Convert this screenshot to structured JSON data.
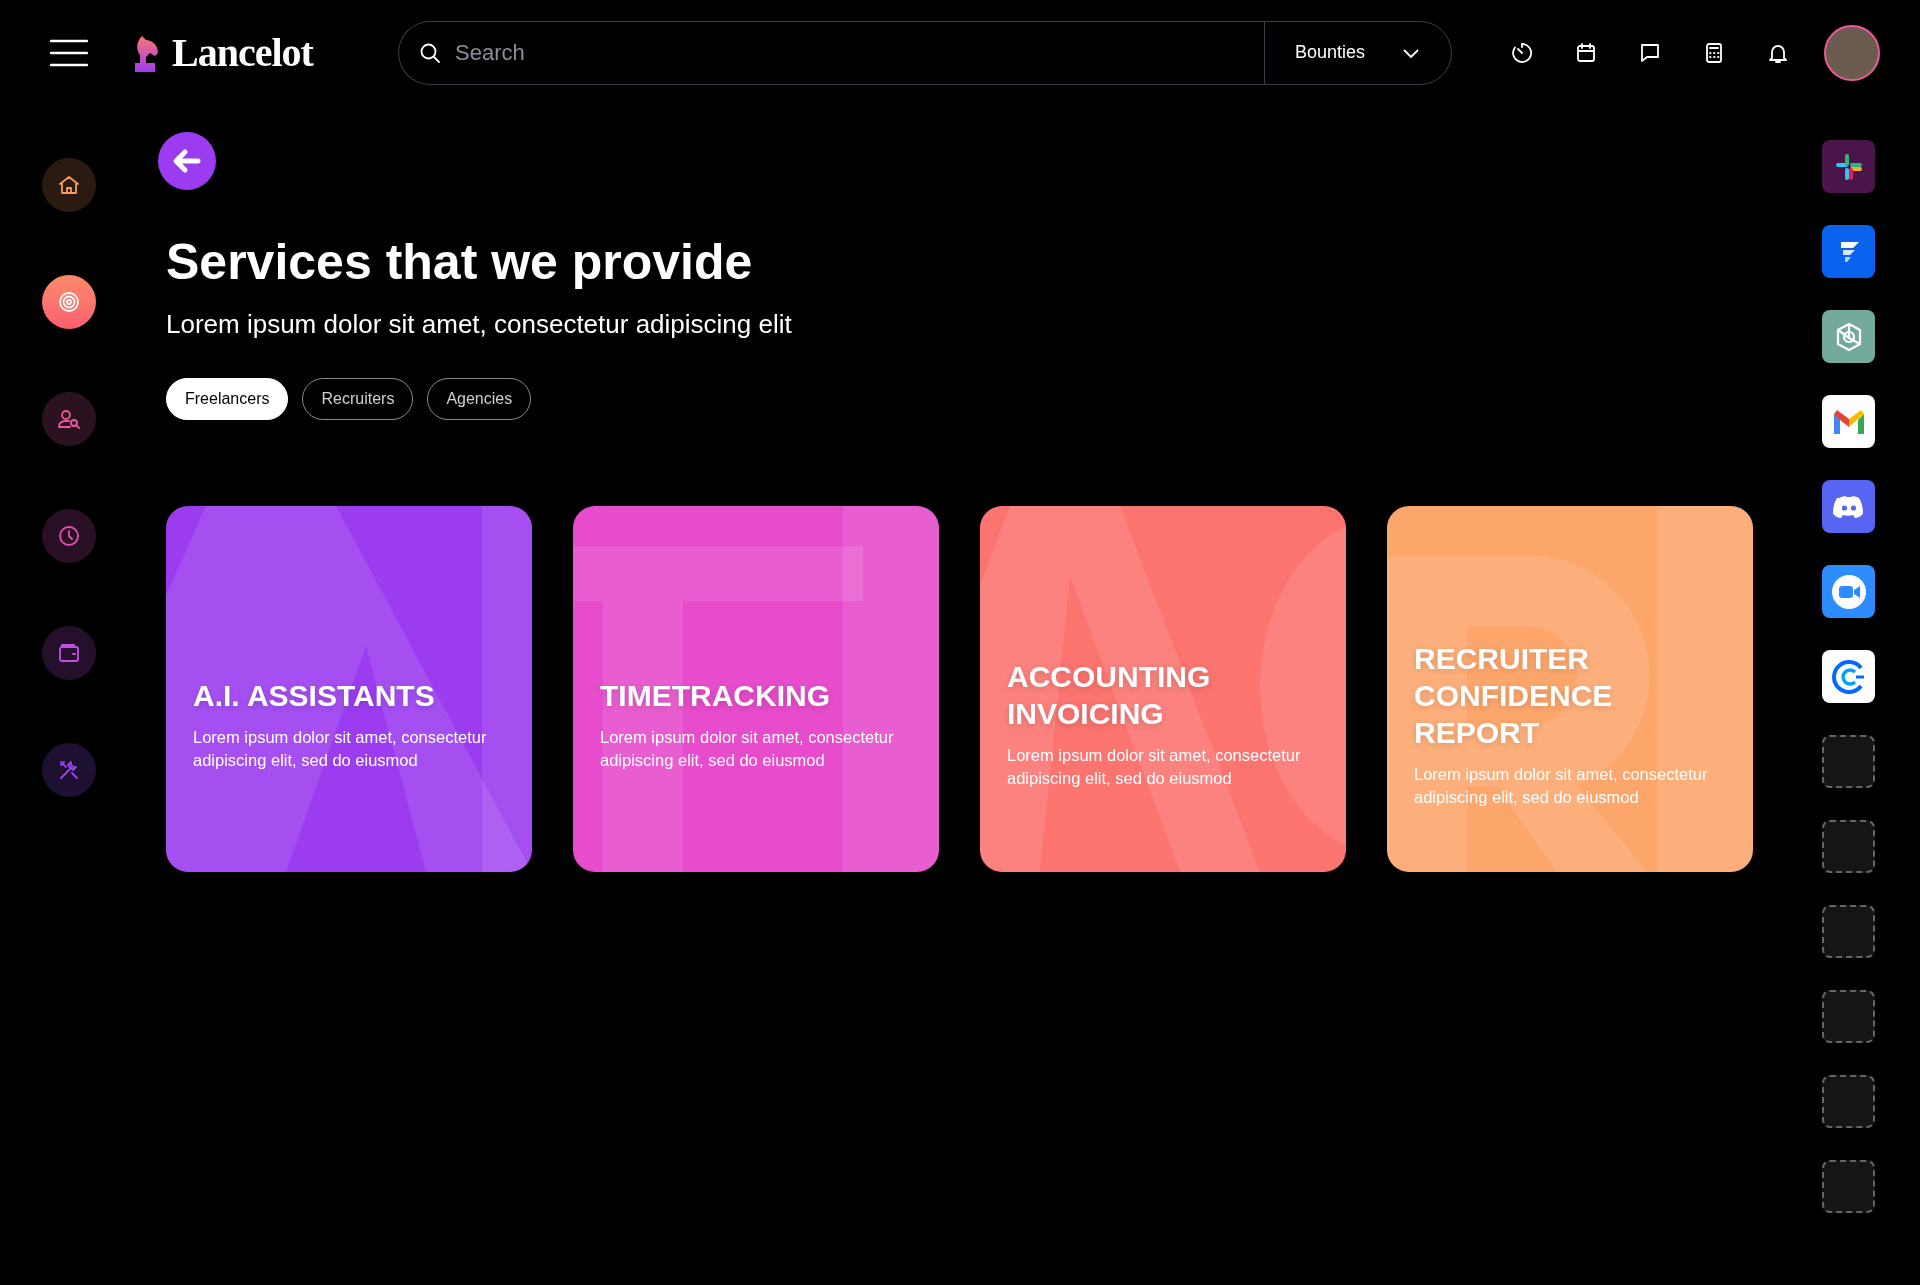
{
  "header": {
    "brand": "Lancelot",
    "search": {
      "placeholder": "Search"
    },
    "scope": "Bounties"
  },
  "sidebar": {
    "items": [
      {
        "kind": "home",
        "selected": false,
        "color": "#f59e5b"
      },
      {
        "kind": "target",
        "selected": true,
        "color": "#ffffff"
      },
      {
        "kind": "user-search",
        "selected": false,
        "color": "#ec5a9b"
      },
      {
        "kind": "clock",
        "selected": false,
        "color": "#e64fb4"
      },
      {
        "kind": "wallet",
        "selected": false,
        "color": "#c84ee6"
      },
      {
        "kind": "tools",
        "selected": false,
        "color": "#9a44f0"
      }
    ]
  },
  "page": {
    "title": "Services that we provide",
    "subtitle": "Lorem ipsum dolor sit amet, consectetur adipiscing elit",
    "filters": [
      {
        "label": "Freelancers",
        "selected": true
      },
      {
        "label": "Recruiters",
        "selected": false
      },
      {
        "label": "Agencies",
        "selected": false
      }
    ],
    "cards": [
      {
        "title_lines": [
          "A.I. ASSISTANTS"
        ],
        "description": "Lorem ipsum dolor sit amet, consectetur adipiscing elit, sed do eiusmod",
        "color": "#9b3cf0"
      },
      {
        "title_lines": [
          "TIMETRACKING"
        ],
        "description": "Lorem ipsum dolor sit amet, consectetur adipiscing elit, sed do eiusmod",
        "color": "#e64ccb"
      },
      {
        "title_lines": [
          "ACCOUNTING",
          "INVOICING"
        ],
        "description": "Lorem ipsum dolor sit amet, consectetur adipiscing elit, sed do eiusmod",
        "color": "#fb7470"
      },
      {
        "title_lines": [
          "RECRUITER",
          "CONFIDENCE",
          "REPORT"
        ],
        "description": "Lorem ipsum dolor sit amet, consectetur adipiscing elit, sed do eiusmod",
        "color": "#fda66c"
      }
    ]
  },
  "app_slots": [
    {
      "kind": "logo"
    },
    {
      "kind": "logo"
    },
    {
      "kind": "logo"
    },
    {
      "kind": "logo"
    },
    {
      "kind": "logo"
    },
    {
      "kind": "logo"
    },
    {
      "kind": "logo"
    },
    {
      "kind": "empty"
    },
    {
      "kind": "empty"
    },
    {
      "kind": "empty"
    },
    {
      "kind": "empty"
    },
    {
      "kind": "empty"
    },
    {
      "kind": "empty"
    }
  ]
}
